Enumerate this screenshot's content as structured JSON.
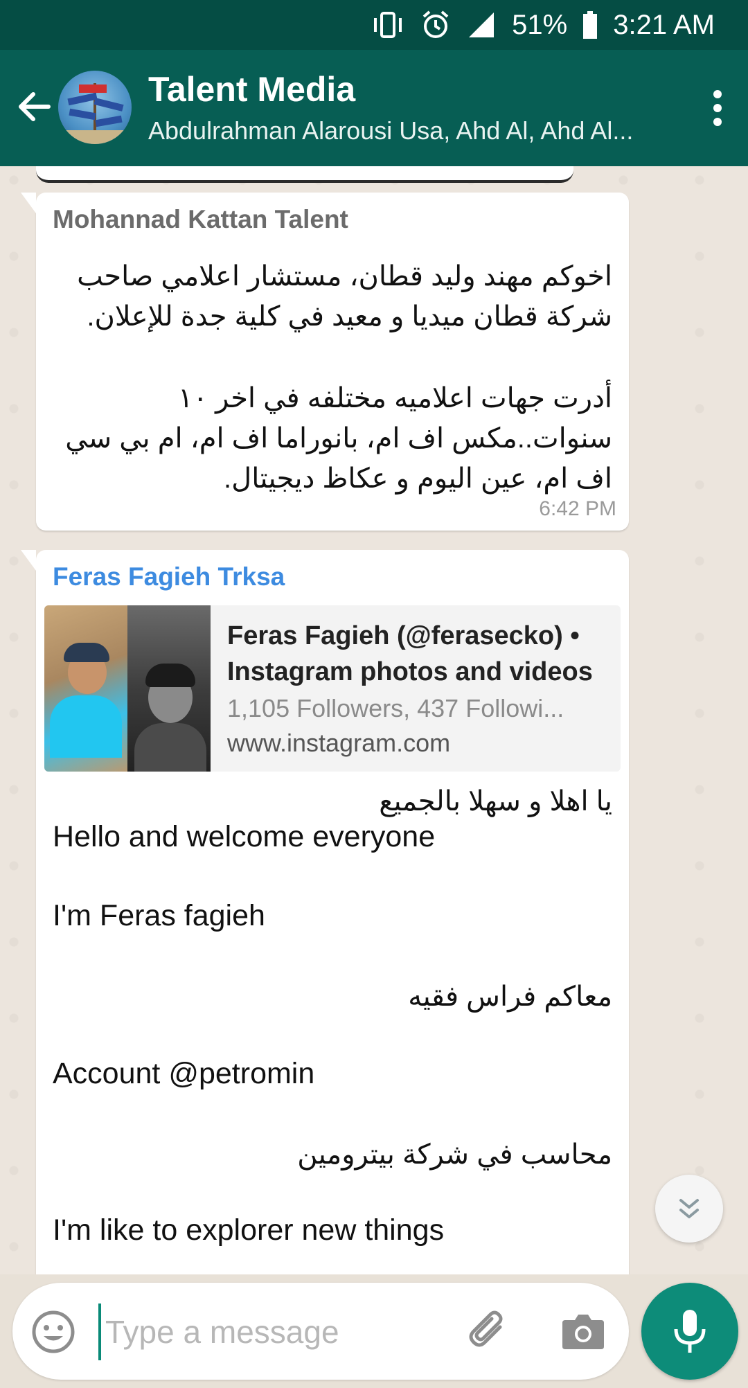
{
  "status_bar": {
    "battery": "51%",
    "time": "3:21 AM"
  },
  "header": {
    "title": "Talent Media",
    "subtitle": "Abdulrahman Alarousi Usa, Ahd Al, Ahd Al..."
  },
  "messages": [
    {
      "sender": "Mohannad Kattan Talent",
      "sender_color": "#6b6b6b",
      "lines": [
        "اخوكم مهند وليد قطان، مستشار اعلامي صاحب",
        "شركة قطان ميديا و معيد في كلية جدة للإعلان.",
        "",
        "أدرت جهات اعلاميه مختلفه في اخر ١٠",
        "سنوات..مكس اف ام، بانوراما اف ام، ام بي سي",
        "اف ام، عين اليوم و عكاظ ديجيتال."
      ],
      "time": "6:42 PM"
    },
    {
      "sender": "Feras Fagieh Trksa",
      "sender_color": "#3d8be0",
      "link_preview": {
        "title": "Feras Fagieh (@ferasecko) • Instagram photos and videos",
        "description": "1,105 Followers, 437 Followi...",
        "url": "www.instagram.com"
      },
      "body": {
        "ar1": "يا اهلا و سهلا بالجميع",
        "en1": "Hello and welcome everyone",
        "en2": "I'm Feras fagieh",
        "ar2": "معاكم فراس فقيه",
        "en3": "Account @petromin",
        "ar3": "محاسب في شركة بيترومين",
        "en4": "I'm like to explorer new things"
      }
    }
  ],
  "composer": {
    "placeholder": "Type a message"
  }
}
